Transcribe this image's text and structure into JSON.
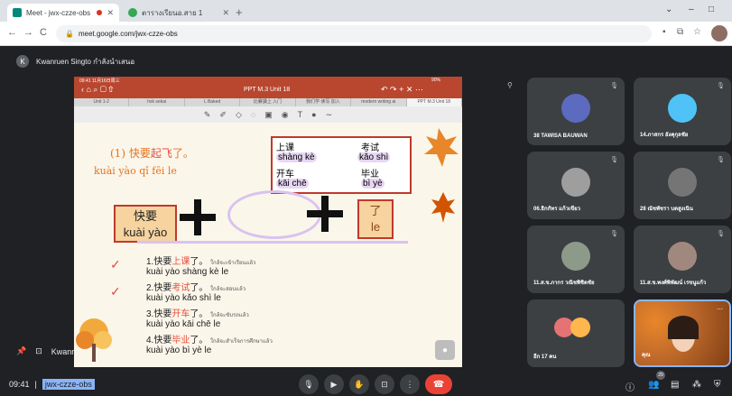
{
  "browser": {
    "tabs": [
      {
        "title": "Meet - jwx-czze-obs",
        "active": true
      },
      {
        "title": "ตารางเรียนอ.สาย 1",
        "active": false
      }
    ],
    "url": "meet.google.com/jwx-czze-obs"
  },
  "meet": {
    "presenter_label": "Kwanruen Singto กำลังนำเสนอ",
    "presenter_footer": "Kwanr",
    "clock": "09:41",
    "meeting_code": "jwx-czze-obs",
    "people_count": "29"
  },
  "ppt": {
    "status_left": "09:41 11月16日周三",
    "title": "PPT M.3 Unit 18",
    "status_right": "90%",
    "tabs": [
      "Unit 1-2",
      "hsk sekai",
      "L Baked",
      "比賽讀上 入门",
      "我们学 读写 加入",
      "modern writing ai",
      "PPT M.3 Unit 18"
    ]
  },
  "slide": {
    "heading_hanzi": "(1) 快要起飞了。",
    "heading_hanzi_highlight": "起飞",
    "heading_pinyin": "kuài yào qǐ fēi le",
    "vocab": [
      {
        "hanzi": "上课",
        "pinyin": "shàng kè"
      },
      {
        "hanzi": "考试",
        "pinyin": "kǎo shì"
      },
      {
        "hanzi": "开车",
        "pinyin": "kāi chē"
      },
      {
        "hanzi": "毕业",
        "pinyin": "bì yè"
      }
    ],
    "box_left_hanzi": "快要",
    "box_left_pinyin": "kuài yào",
    "box_right_hanzi": "了",
    "box_right_pinyin": "le",
    "examples": [
      {
        "num": "1.",
        "pre": "快要",
        "mid": "上课",
        "post": "了。",
        "thai": "ใกล้จะเข้าเรียนแล้ว",
        "pinyin": "kuài yào shàng kè le"
      },
      {
        "num": "2.",
        "pre": "快要",
        "mid": "考试",
        "post": "了。",
        "thai": "ใกล้จะสอบแล้ว",
        "pinyin": "kuài yào kǎo shì le"
      },
      {
        "num": "3.",
        "pre": "快要",
        "mid": "开车",
        "post": "了。",
        "thai": "ใกล้จะขับรถแล้ว",
        "pinyin": "kuài yào kāi chē le"
      },
      {
        "num": "4.",
        "pre": "快要",
        "mid": "毕业",
        "post": "了。",
        "thai": "ใกล้จะสำเร็จการศึกษาแล้ว",
        "pinyin": "kuài yào bì yè le"
      }
    ]
  },
  "participants": [
    {
      "name": "38 TAWISA BAUWAN",
      "color": "#5c6bc0"
    },
    {
      "name": "14.ภาสกร อังคุกุลชัย",
      "color": "#4fc3f7"
    },
    {
      "name": "06.ธิกกัทร แก้วเขียว",
      "color": "#9e9e9e"
    },
    {
      "name": "28 ณัชพัชรา บดสูงเนิน",
      "color": "#757575"
    },
    {
      "name": "11.ส.ข.ภากร วณิชพิชิตชัย",
      "color": "#8d9a8a"
    },
    {
      "name": "11.ส.ข.พงศ์พิพัฒน์ เรขนูแก้ว",
      "color": "#a1887f"
    },
    {
      "name": "อีก 17 คน",
      "color": "#e57373"
    },
    {
      "name": "คุณ",
      "color": "#bf6a2b"
    }
  ]
}
